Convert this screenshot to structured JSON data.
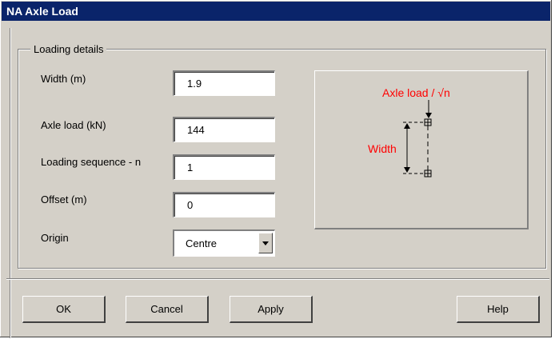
{
  "window": {
    "title": "NA Axle Load"
  },
  "group": {
    "title": "Loading details"
  },
  "fields": {
    "width": {
      "label": "Width (m)",
      "value": "1.9"
    },
    "axle_load": {
      "label": "Axle load (kN)",
      "value": "144"
    },
    "loading_sequence": {
      "label": "Loading sequence - n",
      "value": "1"
    },
    "offset": {
      "label": "Offset (m)",
      "value": "0"
    },
    "origin": {
      "label": "Origin",
      "value": "Centre"
    }
  },
  "diagram": {
    "axle_label": "Axle load / √n",
    "width_label": "Width",
    "label_color": "#ff0000"
  },
  "buttons": {
    "ok": "OK",
    "cancel": "Cancel",
    "apply": "Apply",
    "help": "Help"
  }
}
